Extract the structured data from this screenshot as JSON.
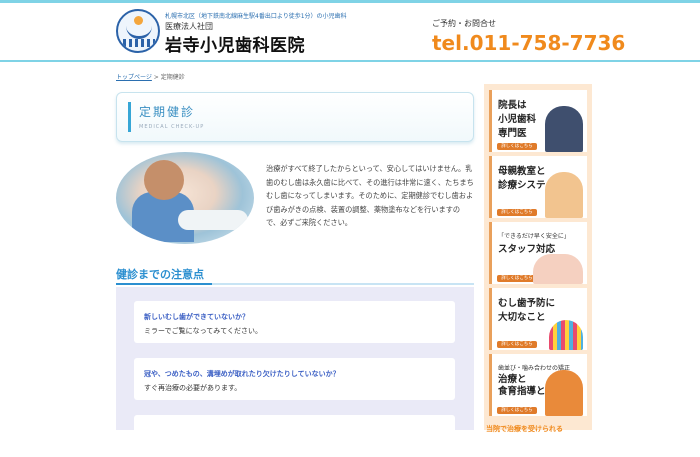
{
  "header": {
    "address": "札幌市北区（地下鉄南北線麻生駅4番出口より徒歩1分）の小児歯科",
    "corporation": "医療法人社団",
    "clinic_name": "岩寺小児歯科医院",
    "tel_label": "ご予約・お問合せ",
    "tel": "tel.011-758-7736"
  },
  "breadcrumb": {
    "home": "トップページ",
    "separator": " > ",
    "current": "定期健診"
  },
  "page_title": {
    "title": "定期健診",
    "subtitle": "MEDICAL CHECK-UP"
  },
  "intro_text": "治療がすべて終了したからといって、安心してはいけません。乳歯のむし歯は永久歯に比べて、その進行は非常に速く、たちまちむし歯になってしまいます。そのために、定期健診でむし歯および歯みがきの点検、装置の調整、薬物塗布などを行いますので、必ずご来院ください。",
  "section": {
    "title": "健診までの注意点"
  },
  "notes": [
    {
      "question": "新しいむし歯ができていないか？",
      "answer": "ミラーでご覧になってみてください。"
    },
    {
      "question": "冠や、つめたもの、溝埋めが取れたり欠けたりしていないか？",
      "answer": "すぐ再治療の必要があります。"
    }
  ],
  "sidebar": {
    "more_label": "詳しくはこちら",
    "banners": [
      {
        "line1": "院長は",
        "line2": "小児歯科",
        "line3": "専門医"
      },
      {
        "line1": "母親教室と",
        "line2": "診療システム",
        "line3": ""
      },
      {
        "small": "「できるだけ早く安全に」",
        "line1": "スタッフ対応",
        "line2": "",
        "line3": ""
      },
      {
        "line1": "むし歯予防に",
        "line2": "大切なこと",
        "line3": ""
      },
      {
        "small": "歯並び・噛み合わせの矯正",
        "line1": "治療と",
        "line2": "食育指導とは",
        "line3": ""
      }
    ],
    "bottom_text": "当院で治療を受けられる"
  },
  "colors": {
    "accent_blue": "#2b8fd0",
    "tel_orange": "#f08a1d",
    "sidebar_bg": "#fde8d2"
  }
}
